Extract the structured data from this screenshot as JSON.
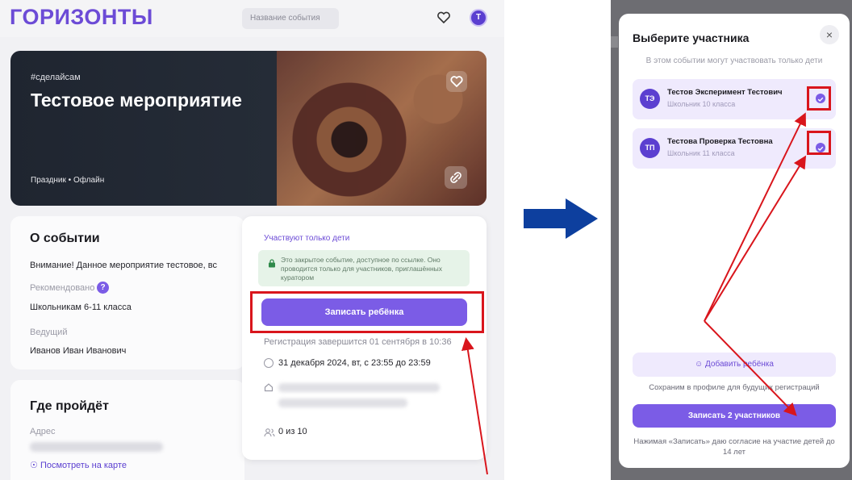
{
  "left": {
    "logo": "ГОРИЗОНТЫ",
    "search_placeholder": "Название события",
    "avatar_letter": "Т",
    "hero": {
      "tag": "#сделайсам",
      "title": "Тестовое мероприятие",
      "meta": "Праздник • Офлайн"
    },
    "about": {
      "title": "О событии",
      "text": "Внимание! Данное мероприятие тестовое, вс",
      "recommended_label": "Рекомендовано",
      "recommended_value": "Школьникам 6-11 класса",
      "host_label": "Ведущий",
      "host_value": "Иванов Иван Иванович"
    },
    "where": {
      "title": "Где пройдёт",
      "address_label": "Адрес",
      "map_link": "Посмотреть на карте"
    },
    "registration": {
      "kids_only": "Участвуют только дети",
      "closed_notice": "Это закрытое событие, доступное по ссылке. Оно проводится только для участников, приглашённых куратором",
      "enroll_button": "Записать ребёнка",
      "reg_ends": "Регистрация завершится 01 сентября в 10:36",
      "date": "31 декабря 2024, вт, с 23:55 до 23:59",
      "participants": "0 из 10"
    }
  },
  "right": {
    "modal_title": "Выберите участника",
    "close": "×",
    "subtitle": "В этом событии могут участвовать только дети",
    "kids": [
      {
        "initials": "ТЭ",
        "name": "Тестов Эксперимент Тестович",
        "grade": "Школьник 10 класса",
        "selected": true
      },
      {
        "initials": "ТП",
        "name": "Тестова Проверка Тестовна",
        "grade": "Школьник 11 класса",
        "selected": true
      }
    ],
    "add_kid": "Добавить ребёнка",
    "save_note": "Сохраним в профиле для будущих регистраций",
    "submit_button": "Записать 2 участников",
    "consent": "Нажимая «Записать» даю согласие на участие детей до 14 лет"
  },
  "colors": {
    "brand_purple": "#7b5ce6",
    "highlight_red": "#d9151c",
    "arrow_blue": "#0d3f9e"
  }
}
